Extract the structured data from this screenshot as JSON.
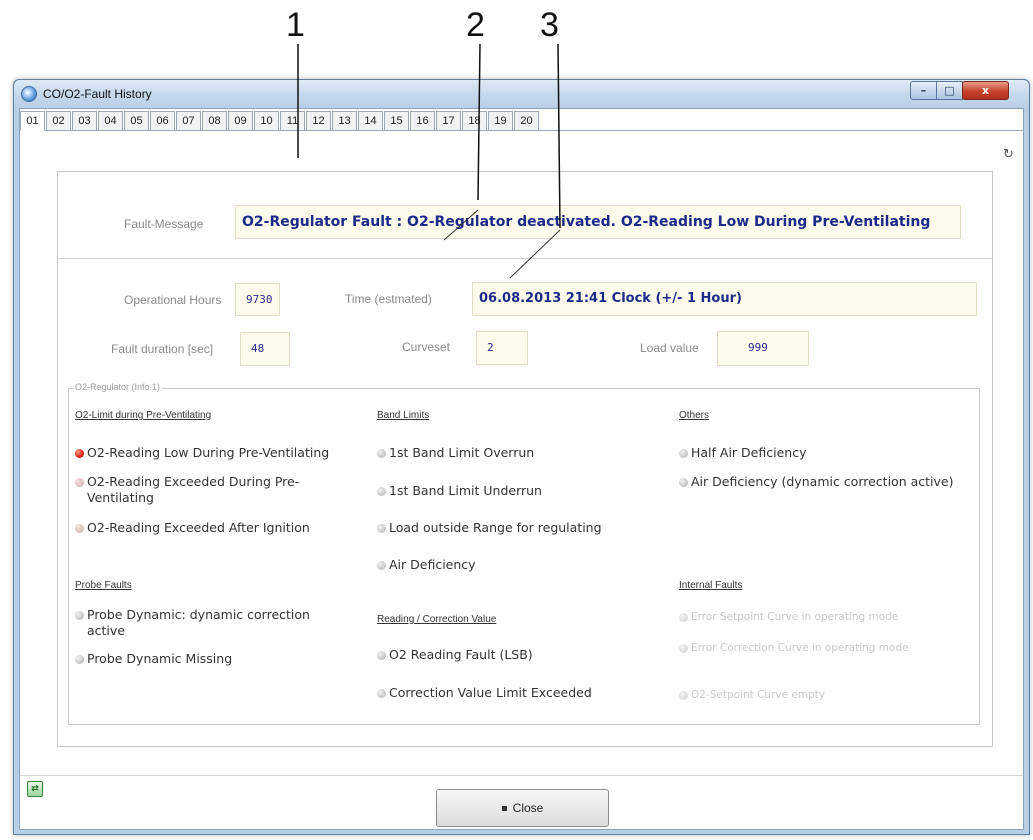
{
  "callouts": [
    "1",
    "2",
    "3"
  ],
  "window": {
    "title": "CO/O2-Fault History",
    "controls": {
      "minimize": "–",
      "maximize": "□",
      "close": "x"
    }
  },
  "tabs": [
    "01",
    "02",
    "03",
    "04",
    "05",
    "06",
    "07",
    "08",
    "09",
    "10",
    "11",
    "12",
    "13",
    "14",
    "15",
    "16",
    "17",
    "18",
    "19",
    "20"
  ],
  "active_tab": "01",
  "fault_message": {
    "label": "Fault-Message",
    "value": "O2-Regulator Fault  :  O2-Regulator deactivated. O2-Reading Low During Pre-Ventilating"
  },
  "info": {
    "operational_hours": {
      "label": "Operational Hours",
      "value": "9730"
    },
    "time": {
      "label": "Time (estmated)",
      "value": "06.08.2013  21:41 Clock  (+/- 1 Hour)"
    },
    "fault_duration": {
      "label": "Fault duration [sec]",
      "value": "48"
    },
    "curveset": {
      "label": "Curveset",
      "value": "2"
    },
    "load_value": {
      "label": "Load value",
      "value": "999"
    }
  },
  "group": {
    "title": "O2-Regulator  (Info 1)",
    "col1": {
      "head1": "O2-Limit during Pre-Ventilating",
      "items1": [
        {
          "label": "O2-Reading Low During Pre-Ventilating",
          "state": "active"
        },
        {
          "label": "O2-Reading Exceeded During Pre-Ventilating",
          "state": "inactive"
        },
        {
          "label": "O2-Reading Exceeded After Ignition",
          "state": "inactive"
        }
      ],
      "head2": "Probe Faults",
      "items2": [
        {
          "label": "Probe Dynamic: dynamic correction active",
          "state": "off"
        },
        {
          "label": "Probe Dynamic Missing",
          "state": "off"
        }
      ]
    },
    "col2": {
      "head1": "Band Limits",
      "items1": [
        {
          "label": "1st Band Limit Overrun",
          "state": "off"
        },
        {
          "label": "1st Band Limit Underrun",
          "state": "off"
        },
        {
          "label": "Load outside Range for regulating",
          "state": "off"
        },
        {
          "label": "Air Deficiency",
          "state": "off"
        }
      ],
      "head2": "Reading / Correction Value",
      "items2": [
        {
          "label": "O2 Reading Fault (LSB)",
          "state": "off"
        },
        {
          "label": "Correction Value Limit Exceeded",
          "state": "off"
        }
      ]
    },
    "col3": {
      "head1": "Others",
      "items1": [
        {
          "label": "Half Air Deficiency",
          "state": "off"
        },
        {
          "label": "Air Deficiency (dynamic correction active)",
          "state": "off"
        }
      ],
      "head2": "Internal Faults",
      "items2": [
        {
          "label": "Error Setpoint Curve in operating mode",
          "state": "disabled"
        },
        {
          "label": "Error Correction Curve in operating mode",
          "state": "disabled"
        },
        {
          "label": "O2-Setpoint Curve empty",
          "state": "disabled"
        }
      ]
    }
  },
  "footer": {
    "close_label": "Close"
  }
}
